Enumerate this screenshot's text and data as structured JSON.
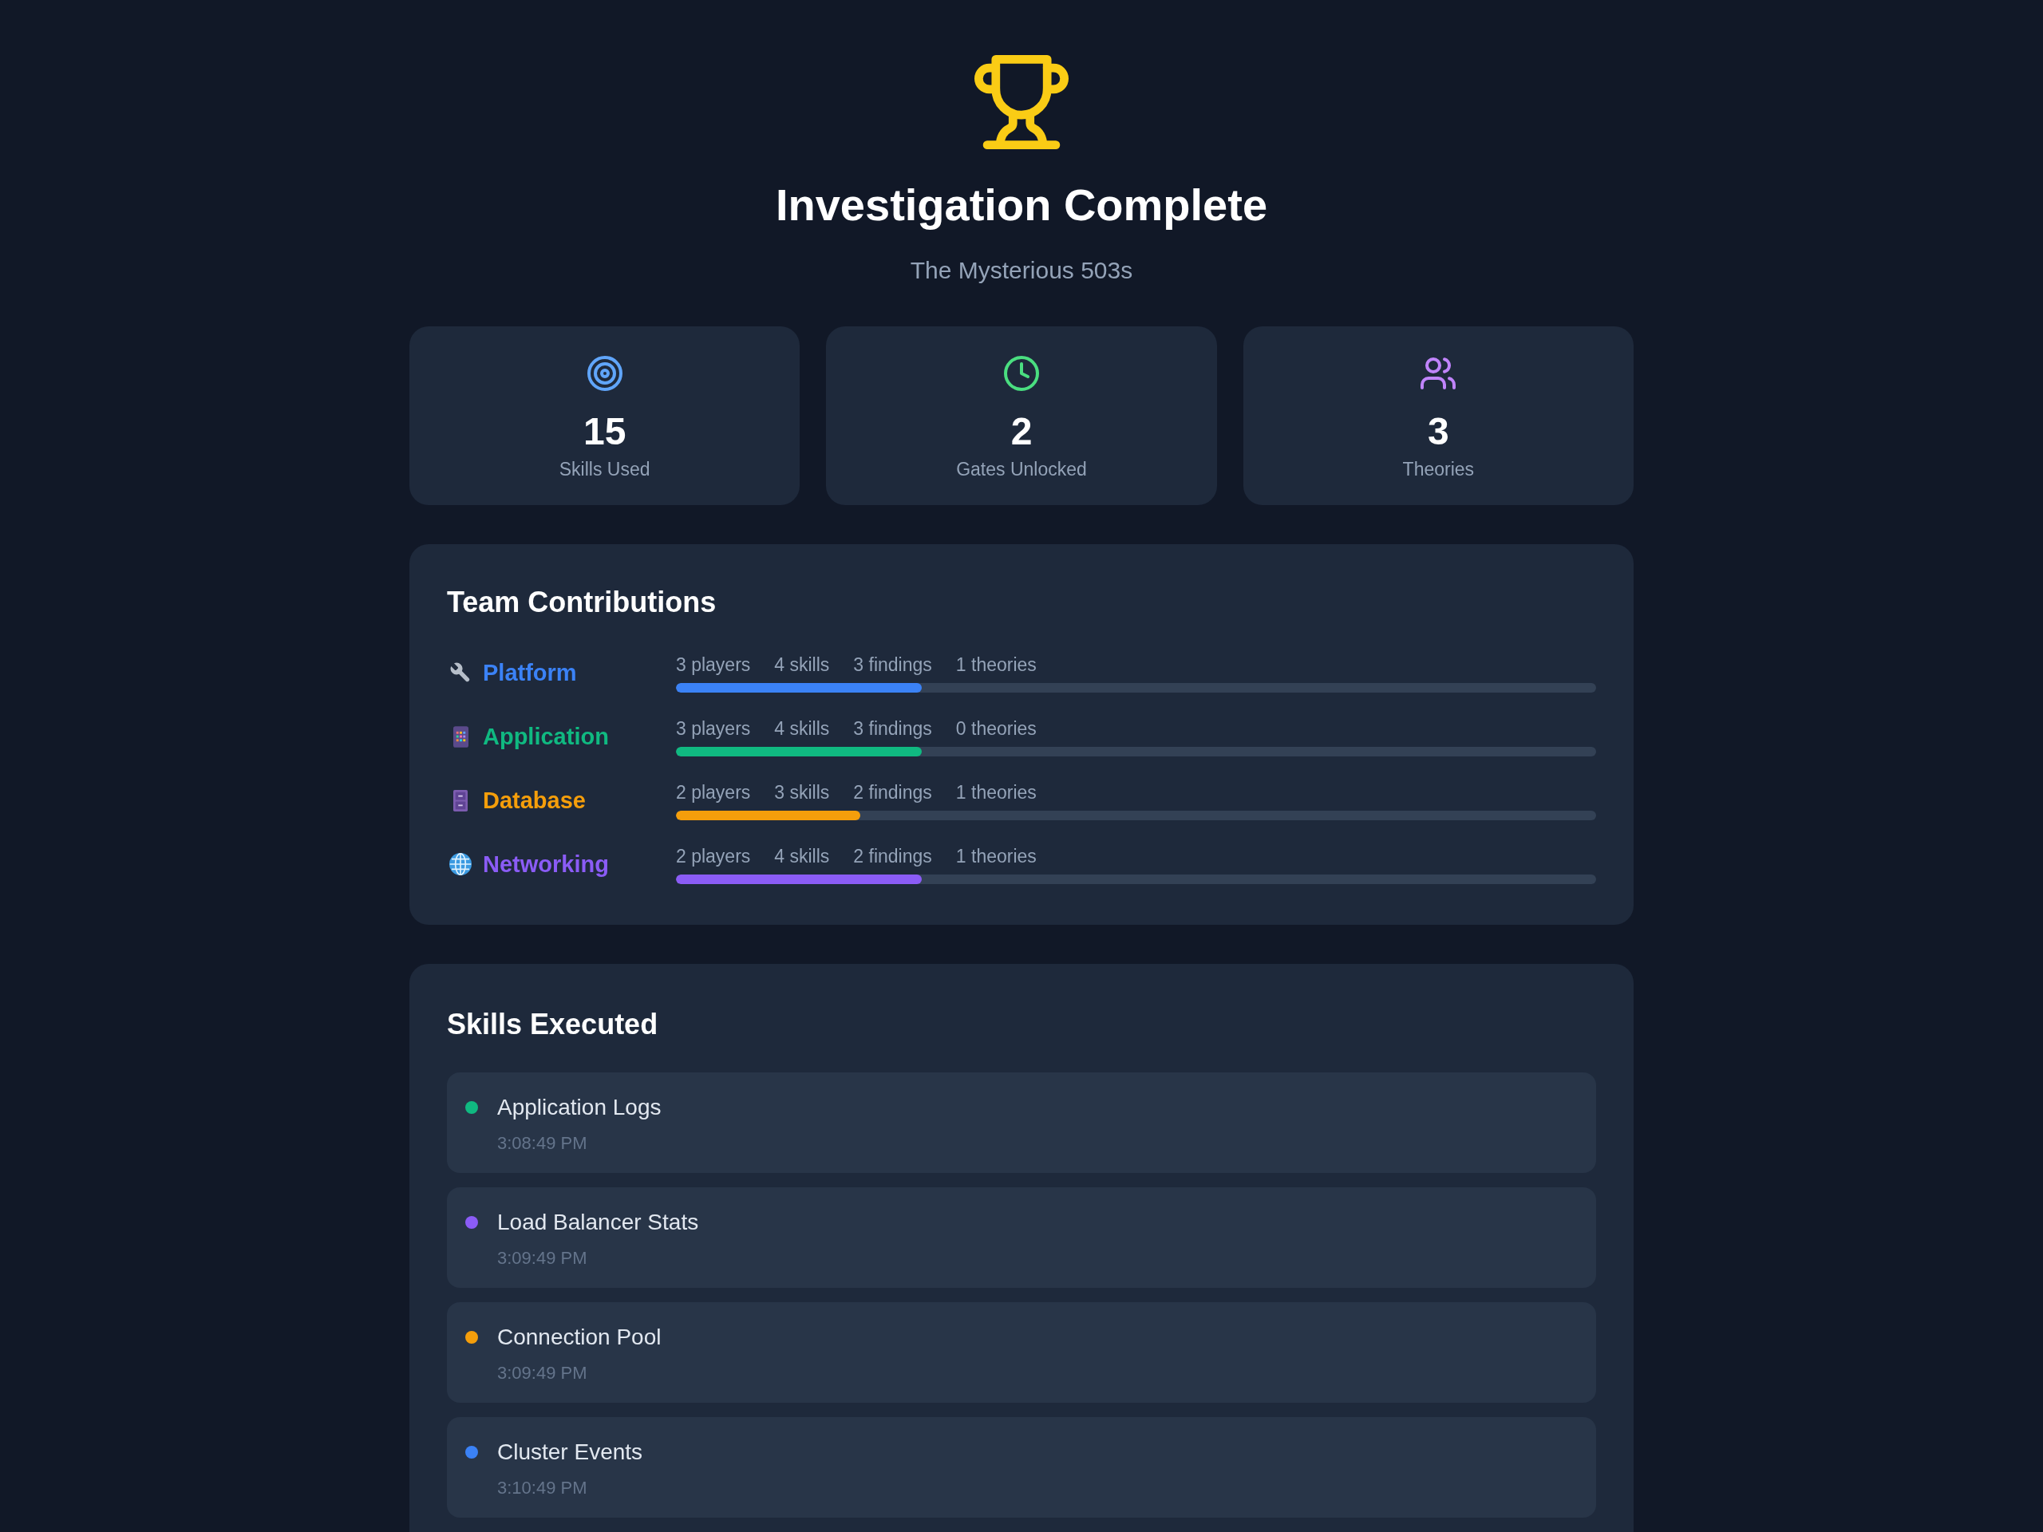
{
  "header": {
    "title": "Investigation Complete",
    "subtitle": "The Mysterious 503s"
  },
  "stats": [
    {
      "value": "15",
      "label": "Skills Used",
      "color": "#60a5fa"
    },
    {
      "value": "2",
      "label": "Gates Unlocked",
      "color": "#4ade80"
    },
    {
      "value": "3",
      "label": "Theories",
      "color": "#c084fc"
    }
  ],
  "team_contributions": {
    "title": "Team Contributions",
    "teams": [
      {
        "name": "Platform",
        "color": "#3b82f6",
        "stats": [
          "3 players",
          "4 skills",
          "3 findings",
          "1 theories"
        ],
        "level": 0.267
      },
      {
        "name": "Application",
        "color": "#10b981",
        "stats": [
          "3 players",
          "4 skills",
          "3 findings",
          "0 theories"
        ],
        "level": 0.267
      },
      {
        "name": "Database",
        "color": "#f59e0b",
        "stats": [
          "2 players",
          "3 skills",
          "2 findings",
          "1 theories"
        ],
        "level": 0.2
      },
      {
        "name": "Networking",
        "color": "#8b5cf6",
        "stats": [
          "2 players",
          "4 skills",
          "2 findings",
          "1 theories"
        ],
        "level": 0.267
      }
    ]
  },
  "skills_executed": {
    "title": "Skills Executed",
    "items": [
      {
        "name": "Application Logs",
        "time": "3:08:49 PM",
        "color": "#10b981"
      },
      {
        "name": "Load Balancer Stats",
        "time": "3:09:49 PM",
        "color": "#8b5cf6"
      },
      {
        "name": "Connection Pool",
        "time": "3:09:49 PM",
        "color": "#f59e0b"
      },
      {
        "name": "Cluster Events",
        "time": "3:10:49 PM",
        "color": "#3b82f6"
      }
    ]
  }
}
